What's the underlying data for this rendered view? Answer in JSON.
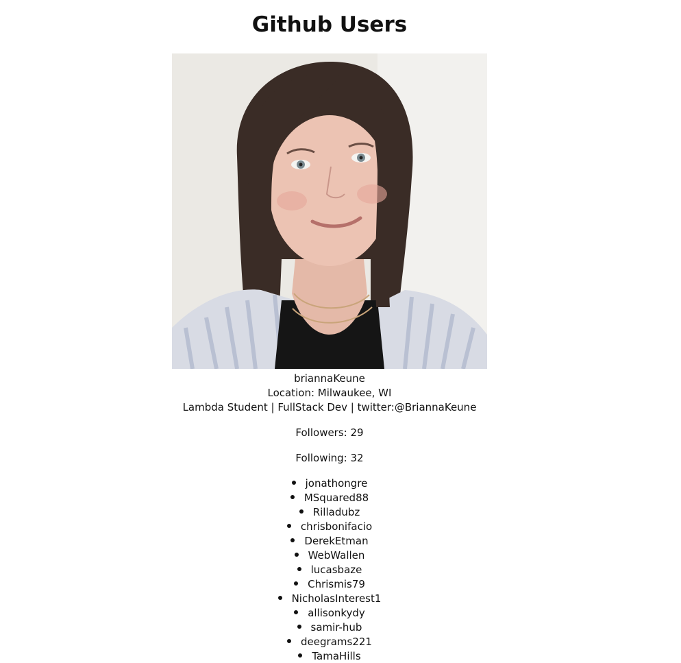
{
  "page": {
    "title": "Github Users"
  },
  "user": {
    "login": "briannaKeune",
    "location": "Location: Milwaukee, WI",
    "bio": "Lambda Student | FullStack Dev | twitter:@BriannaKeune",
    "followers": "Followers: 29",
    "following": "Following: 32"
  },
  "followers_list": [
    "jonathongre",
    "MSquared88",
    "Rilladubz",
    "chrisbonifacio",
    "DerekEtman",
    "WebWallen",
    "lucasbaze",
    "Chrismis79",
    "NicholasInterest1",
    "allisonkydy",
    "samir-hub",
    "deegrams221",
    "TamaHills"
  ],
  "colors": {
    "text": "#111111",
    "background": "#ffffff"
  }
}
